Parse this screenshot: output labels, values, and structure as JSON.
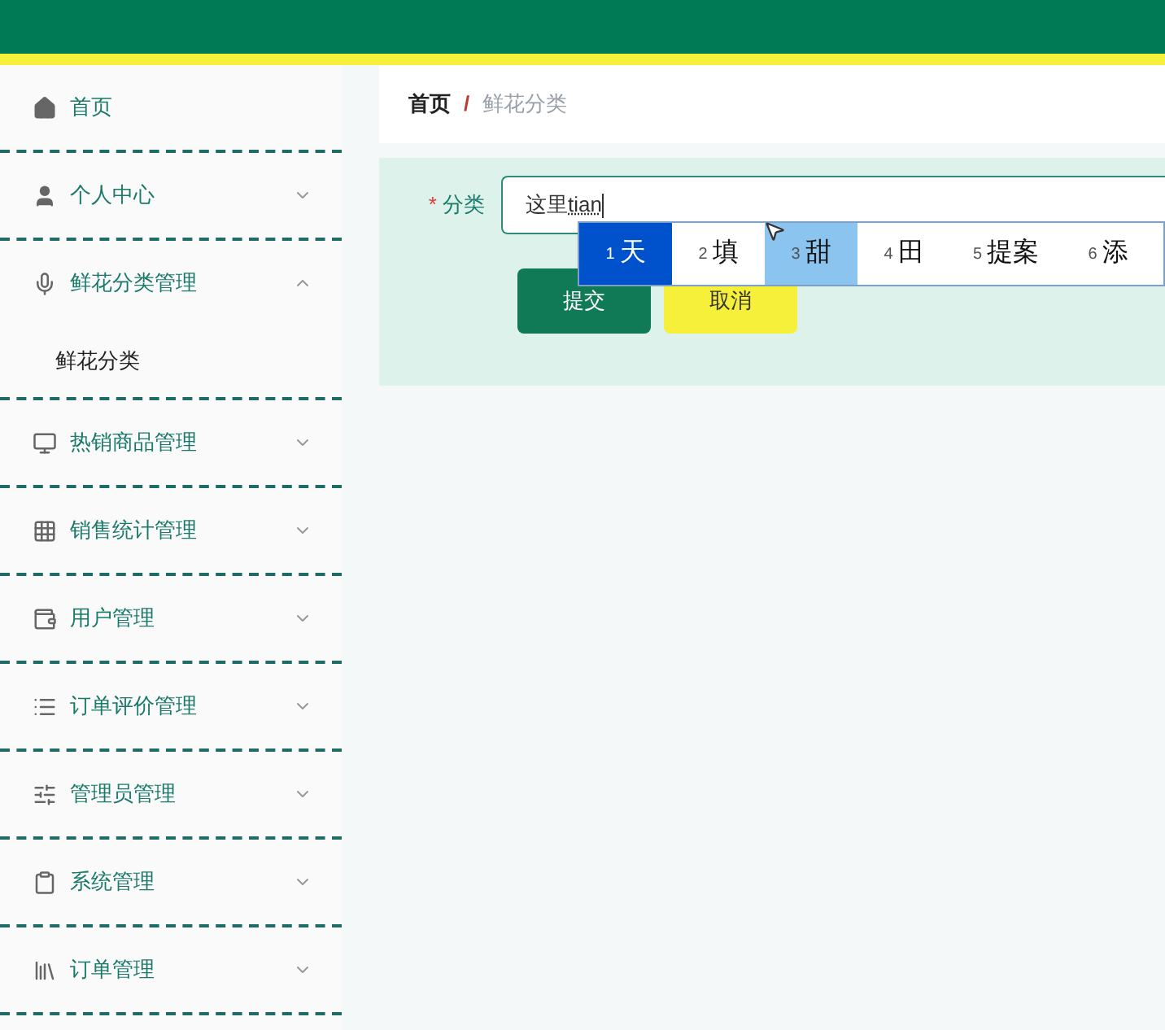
{
  "sidebar": {
    "items": [
      {
        "label": "首页",
        "kind": "link"
      },
      {
        "label": "个人中心",
        "kind": "menu",
        "expanded": false
      },
      {
        "label": "鲜花分类管理",
        "kind": "menu",
        "expanded": true,
        "children": [
          {
            "label": "鲜花分类"
          }
        ]
      },
      {
        "label": "热销商品管理",
        "kind": "menu",
        "expanded": false
      },
      {
        "label": "销售统计管理",
        "kind": "menu",
        "expanded": false
      },
      {
        "label": "用户管理",
        "kind": "menu",
        "expanded": false
      },
      {
        "label": "订单评价管理",
        "kind": "menu",
        "expanded": false
      },
      {
        "label": "管理员管理",
        "kind": "menu",
        "expanded": false
      },
      {
        "label": "系统管理",
        "kind": "menu",
        "expanded": false
      },
      {
        "label": "订单管理",
        "kind": "menu",
        "expanded": false
      }
    ]
  },
  "breadcrumb": {
    "home": "首页",
    "separator": "/",
    "current": "鲜花分类"
  },
  "form": {
    "field": {
      "required_mark": "*",
      "label": "分类",
      "value": "这里",
      "composing": "tian"
    },
    "buttons": [
      {
        "label": "提交",
        "kind": "primary"
      },
      {
        "label": "取消",
        "kind": "cancel"
      }
    ]
  },
  "ime": {
    "candidates": [
      {
        "number": "1",
        "text": "天",
        "selected": true,
        "hovered": false
      },
      {
        "number": "2",
        "text": "填",
        "selected": false,
        "hovered": false
      },
      {
        "number": "3",
        "text": "甜",
        "selected": false,
        "hovered": true
      },
      {
        "number": "4",
        "text": "田",
        "selected": false,
        "hovered": false
      },
      {
        "number": "5",
        "text": "提案",
        "selected": false,
        "hovered": false
      },
      {
        "number": "6",
        "text": "添",
        "selected": false,
        "hovered": false
      }
    ]
  }
}
